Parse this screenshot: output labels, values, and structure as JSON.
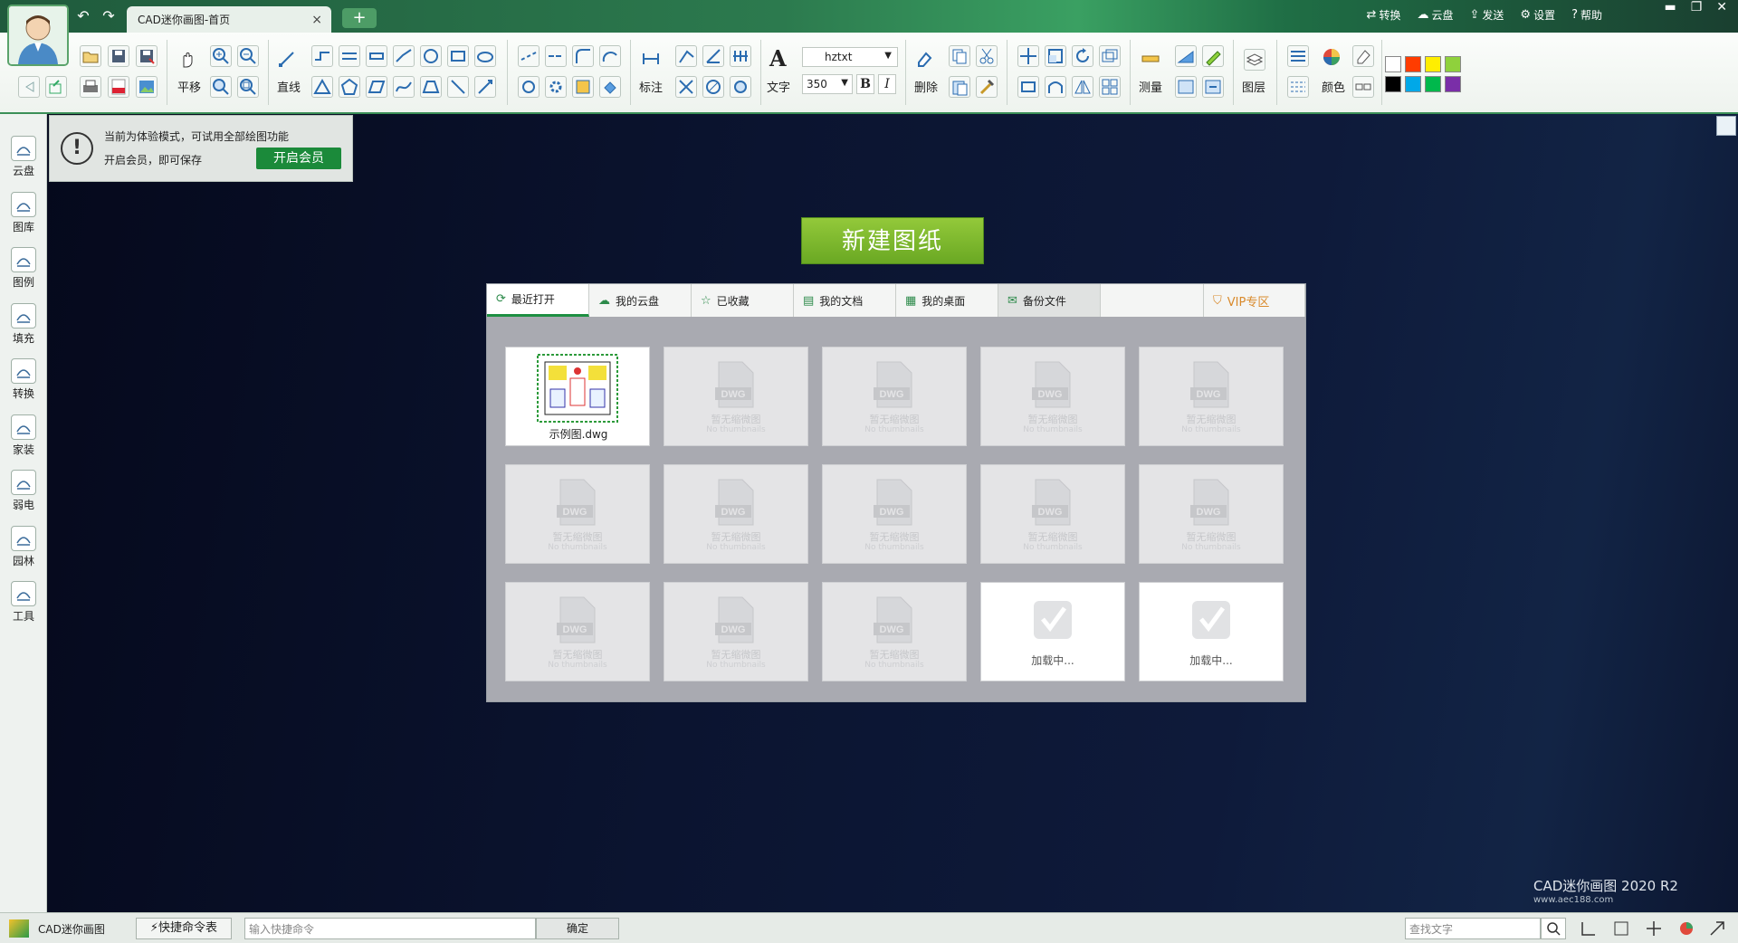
{
  "window": {
    "tab_title": "CAD迷你画图-首页",
    "tab_close": "×",
    "tab_add": "+",
    "nav_back": "↶",
    "nav_forward": "↷",
    "top_links": [
      {
        "icon": "convert-icon",
        "glyph": "⇄",
        "label": "转换"
      },
      {
        "icon": "cloud-icon",
        "glyph": "☁",
        "label": "云盘"
      },
      {
        "icon": "send-icon",
        "glyph": "⇪",
        "label": "发送"
      },
      {
        "icon": "gear-icon",
        "glyph": "⚙",
        "label": "设置"
      },
      {
        "icon": "help-icon",
        "glyph": "?",
        "label": "帮助"
      }
    ],
    "controls": {
      "minimize": "▬",
      "maximize": "❐",
      "close": "✕"
    }
  },
  "ribbon": {
    "pan_label": "平移",
    "line_label": "直线",
    "dimension_label": "标注",
    "text_label": "文字",
    "font_name": "hztxt",
    "font_size": "350",
    "bold": "B",
    "italic": "I",
    "delete_label": "删除",
    "measure_label": "测量",
    "layer_label": "图层",
    "color_label": "颜色",
    "swatches": [
      "#ffffff",
      "#ff3c00",
      "#ffee00",
      "#8fd13c",
      "#000000",
      "#00a8e8",
      "#00b84c",
      "#7a2ea8"
    ]
  },
  "sidebar": {
    "items": [
      {
        "name": "cloud",
        "label": "云盘"
      },
      {
        "name": "gallery",
        "label": "图库"
      },
      {
        "name": "legend",
        "label": "图例"
      },
      {
        "name": "fill",
        "label": "填充"
      },
      {
        "name": "convert",
        "label": "转换"
      },
      {
        "name": "home-decor",
        "label": "家装"
      },
      {
        "name": "low-voltage",
        "label": "弱电"
      },
      {
        "name": "garden",
        "label": "园林"
      },
      {
        "name": "tools",
        "label": "工具"
      }
    ]
  },
  "notice": {
    "line1": "当前为体验模式，可试用全部绘图功能",
    "line2": "开启会员，即可保存",
    "button": "开启会员"
  },
  "main": {
    "new_drawing": "新建图纸",
    "tabs": [
      {
        "label": "最近打开",
        "glyph": "⟳"
      },
      {
        "label": "我的云盘",
        "glyph": "☁"
      },
      {
        "label": "已收藏",
        "glyph": "☆"
      },
      {
        "label": "我的文档",
        "glyph": "▤"
      },
      {
        "label": "我的桌面",
        "glyph": "▦"
      },
      {
        "label": "备份文件",
        "glyph": "✉"
      }
    ],
    "vip_tab": {
      "label": "VIP专区",
      "glyph": "⛉"
    },
    "first_file": "示例图.dwg",
    "dwg_badge": "DWG",
    "no_thumb_cn": "暂无缩微图",
    "no_thumb_en": "No thumbnails",
    "loading": "加载中..."
  },
  "brand": {
    "title": "CAD迷你画图 2020 R2",
    "site": "www.aec188.com"
  },
  "statusbar": {
    "app_name": "CAD迷你画图",
    "quick_cmd": "⚡快捷命令表",
    "cmd_placeholder": "输入快捷命令",
    "ok": "确定",
    "find_placeholder": "查找文字"
  }
}
